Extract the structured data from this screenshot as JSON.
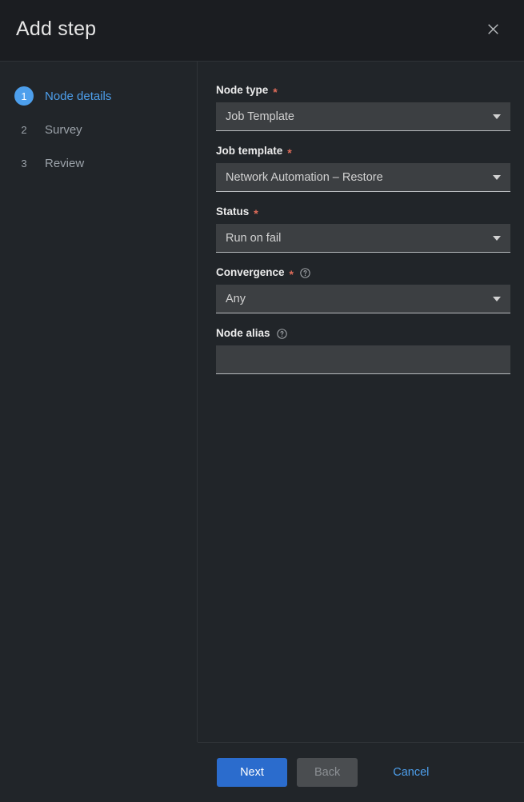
{
  "header": {
    "title": "Add step",
    "close_icon": "close-icon"
  },
  "steps": [
    {
      "index": "1",
      "label": "Node details",
      "active": true
    },
    {
      "index": "2",
      "label": "Survey",
      "active": false
    },
    {
      "index": "3",
      "label": "Review",
      "active": false
    }
  ],
  "form": {
    "required_mark": "*",
    "fields": [
      {
        "name": "node-type",
        "label": "Node type",
        "required": true,
        "help": false,
        "type": "select",
        "value": "Job Template",
        "placeholder": ""
      },
      {
        "name": "job-template",
        "label": "Job template",
        "required": true,
        "help": false,
        "type": "select",
        "value": "Network Automation – Restore",
        "placeholder": ""
      },
      {
        "name": "status",
        "label": "Status",
        "required": true,
        "help": false,
        "type": "select",
        "value": "Run on fail",
        "placeholder": ""
      },
      {
        "name": "convergence",
        "label": "Convergence",
        "required": true,
        "help": true,
        "type": "select",
        "value": "Any",
        "placeholder": ""
      },
      {
        "name": "node-alias",
        "label": "Node alias",
        "required": false,
        "help": true,
        "type": "text",
        "value": "",
        "placeholder": ""
      }
    ]
  },
  "footer": {
    "next_label": "Next",
    "back_label": "Back",
    "cancel_label": "Cancel"
  },
  "colors": {
    "accent_blue": "#4d9fec",
    "primary_button": "#2b6ccd",
    "required_red": "#e06c5a",
    "panel_bg": "#212529",
    "header_bg": "#1b1d21",
    "control_bg": "#3c3f42"
  }
}
